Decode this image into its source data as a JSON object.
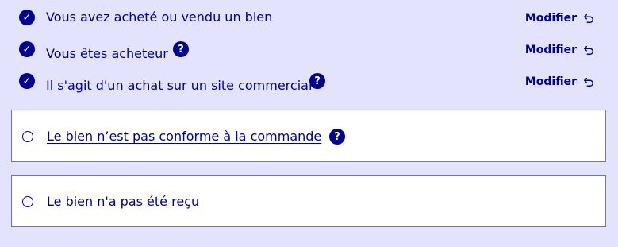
{
  "steps": [
    {
      "label": "Vous avez acheté ou vendu un bien",
      "has_help": false,
      "modify_label": "Modifier"
    },
    {
      "label": "Vous êtes acheteur",
      "has_help": true,
      "modify_label": "Modifier"
    },
    {
      "label": "Il s'agit d'un achat sur un site commercial",
      "has_help": true,
      "modify_label": "Modifier"
    }
  ],
  "help_glyph": "?",
  "check_glyph": "✓",
  "choices": [
    {
      "label": "Le bien n’est pas conforme à la commande",
      "has_help": true
    },
    {
      "label": "Le bien n'a pas été reçu",
      "has_help": false
    }
  ],
  "colors": {
    "background": "#e3e3fd",
    "primary": "#000091",
    "border": "#6a6af4",
    "card": "#ffffff"
  },
  "icons": {
    "check": "check-circle-icon",
    "help": "question-circle-icon",
    "modify": "undo-arrow-icon"
  }
}
